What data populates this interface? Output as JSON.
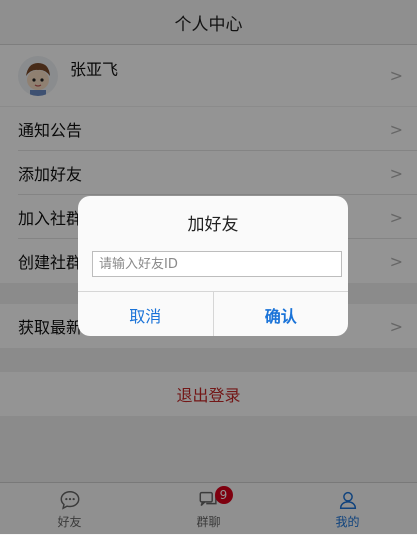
{
  "header": {
    "title": "个人中心"
  },
  "profile": {
    "name": "张亚飞"
  },
  "menu": {
    "notice": "通知公告",
    "add_friend": "添加好友",
    "join_community": "加入社群",
    "create_community": "创建社群",
    "get_latest_code": "获取最新代码",
    "chevron": ">"
  },
  "logout": {
    "label": "退出登录"
  },
  "tabs": [
    {
      "label": "好友",
      "icon": "chat-bubble-icon"
    },
    {
      "label": "群聊",
      "icon": "group-chat-icon",
      "badge": "9"
    },
    {
      "label": "我的",
      "icon": "user-icon"
    }
  ],
  "dialog": {
    "title": "加好友",
    "input_placeholder": "请输入好友ID",
    "input_value": "",
    "cancel_label": "取消",
    "confirm_label": "确认"
  },
  "colors": {
    "accent": "#1a73d8",
    "danger": "#c62828",
    "badge": "#d9001b"
  }
}
